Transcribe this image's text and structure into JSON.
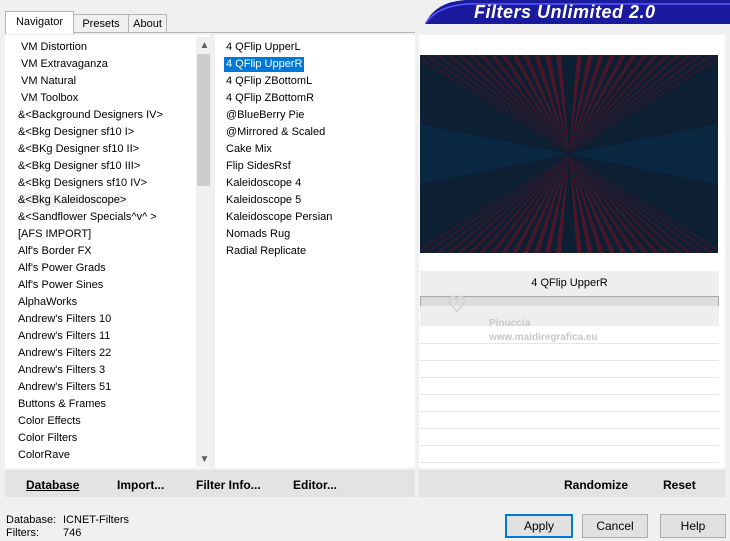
{
  "tabs": [
    {
      "label": "Navigator",
      "active": true
    },
    {
      "label": "Presets",
      "active": false
    },
    {
      "label": "About",
      "active": false
    }
  ],
  "banner": {
    "title": "Filters Unlimited 2.0"
  },
  "categories": [
    "VM Distortion",
    "VM Extravaganza",
    "VM Natural",
    "VM Toolbox",
    "&<Background Designers IV>",
    "&<Bkg Designer sf10 I>",
    "&<BKg Designer sf10 II>",
    "&<Bkg Designer sf10 III>",
    "&<Bkg Designers sf10 IV>",
    "&<Bkg Kaleidoscope>",
    "&<Sandflower Specials^v^ >",
    "[AFS IMPORT]",
    "Alf's Border FX",
    "Alf's Power Grads",
    "Alf's Power Sines",
    "AlphaWorks",
    "Andrew's Filters 10",
    "Andrew's Filters 11",
    "Andrew's Filters 22",
    "Andrew's Filters 3",
    "Andrew's Filters 51",
    "Buttons & Frames",
    "Color Effects",
    "Color Filters",
    "ColorRave"
  ],
  "categories_selected_index": 9,
  "filters": [
    "4 QFlip UpperL",
    "4 QFlip UpperR",
    "4 QFlip ZBottomL",
    "4 QFlip ZBottomR",
    "@BlueBerry Pie",
    "@Mirrored & Scaled",
    "Cake Mix",
    "Flip SidesRsf",
    "Kaleidoscope 4",
    "Kaleidoscope 5",
    "Kaleidoscope Persian",
    "Nomads Rug",
    "Radial Replicate"
  ],
  "filters_selected_index": 1,
  "preview": {
    "filter_name": "4 QFlip UpperR",
    "colors": {
      "dark": "#0c1f33",
      "red": "#8a0f1e"
    }
  },
  "watermark": {
    "line1": "Pinuccia",
    "line2": "www.maidiregrafica.eu"
  },
  "left_buttons": {
    "database": "Database",
    "import": "Import...",
    "filter_info": "Filter Info...",
    "editor": "Editor..."
  },
  "right_buttons": {
    "randomize": "Randomize",
    "reset": "Reset"
  },
  "status": {
    "database_label": "Database:",
    "database_value": "ICNET-Filters",
    "filters_label": "Filters:",
    "filters_value": "746"
  },
  "dialog_buttons": {
    "apply": "Apply",
    "cancel": "Cancel",
    "help": "Help"
  },
  "accent": "#0078d7",
  "banner_color": "#1a1a9e"
}
